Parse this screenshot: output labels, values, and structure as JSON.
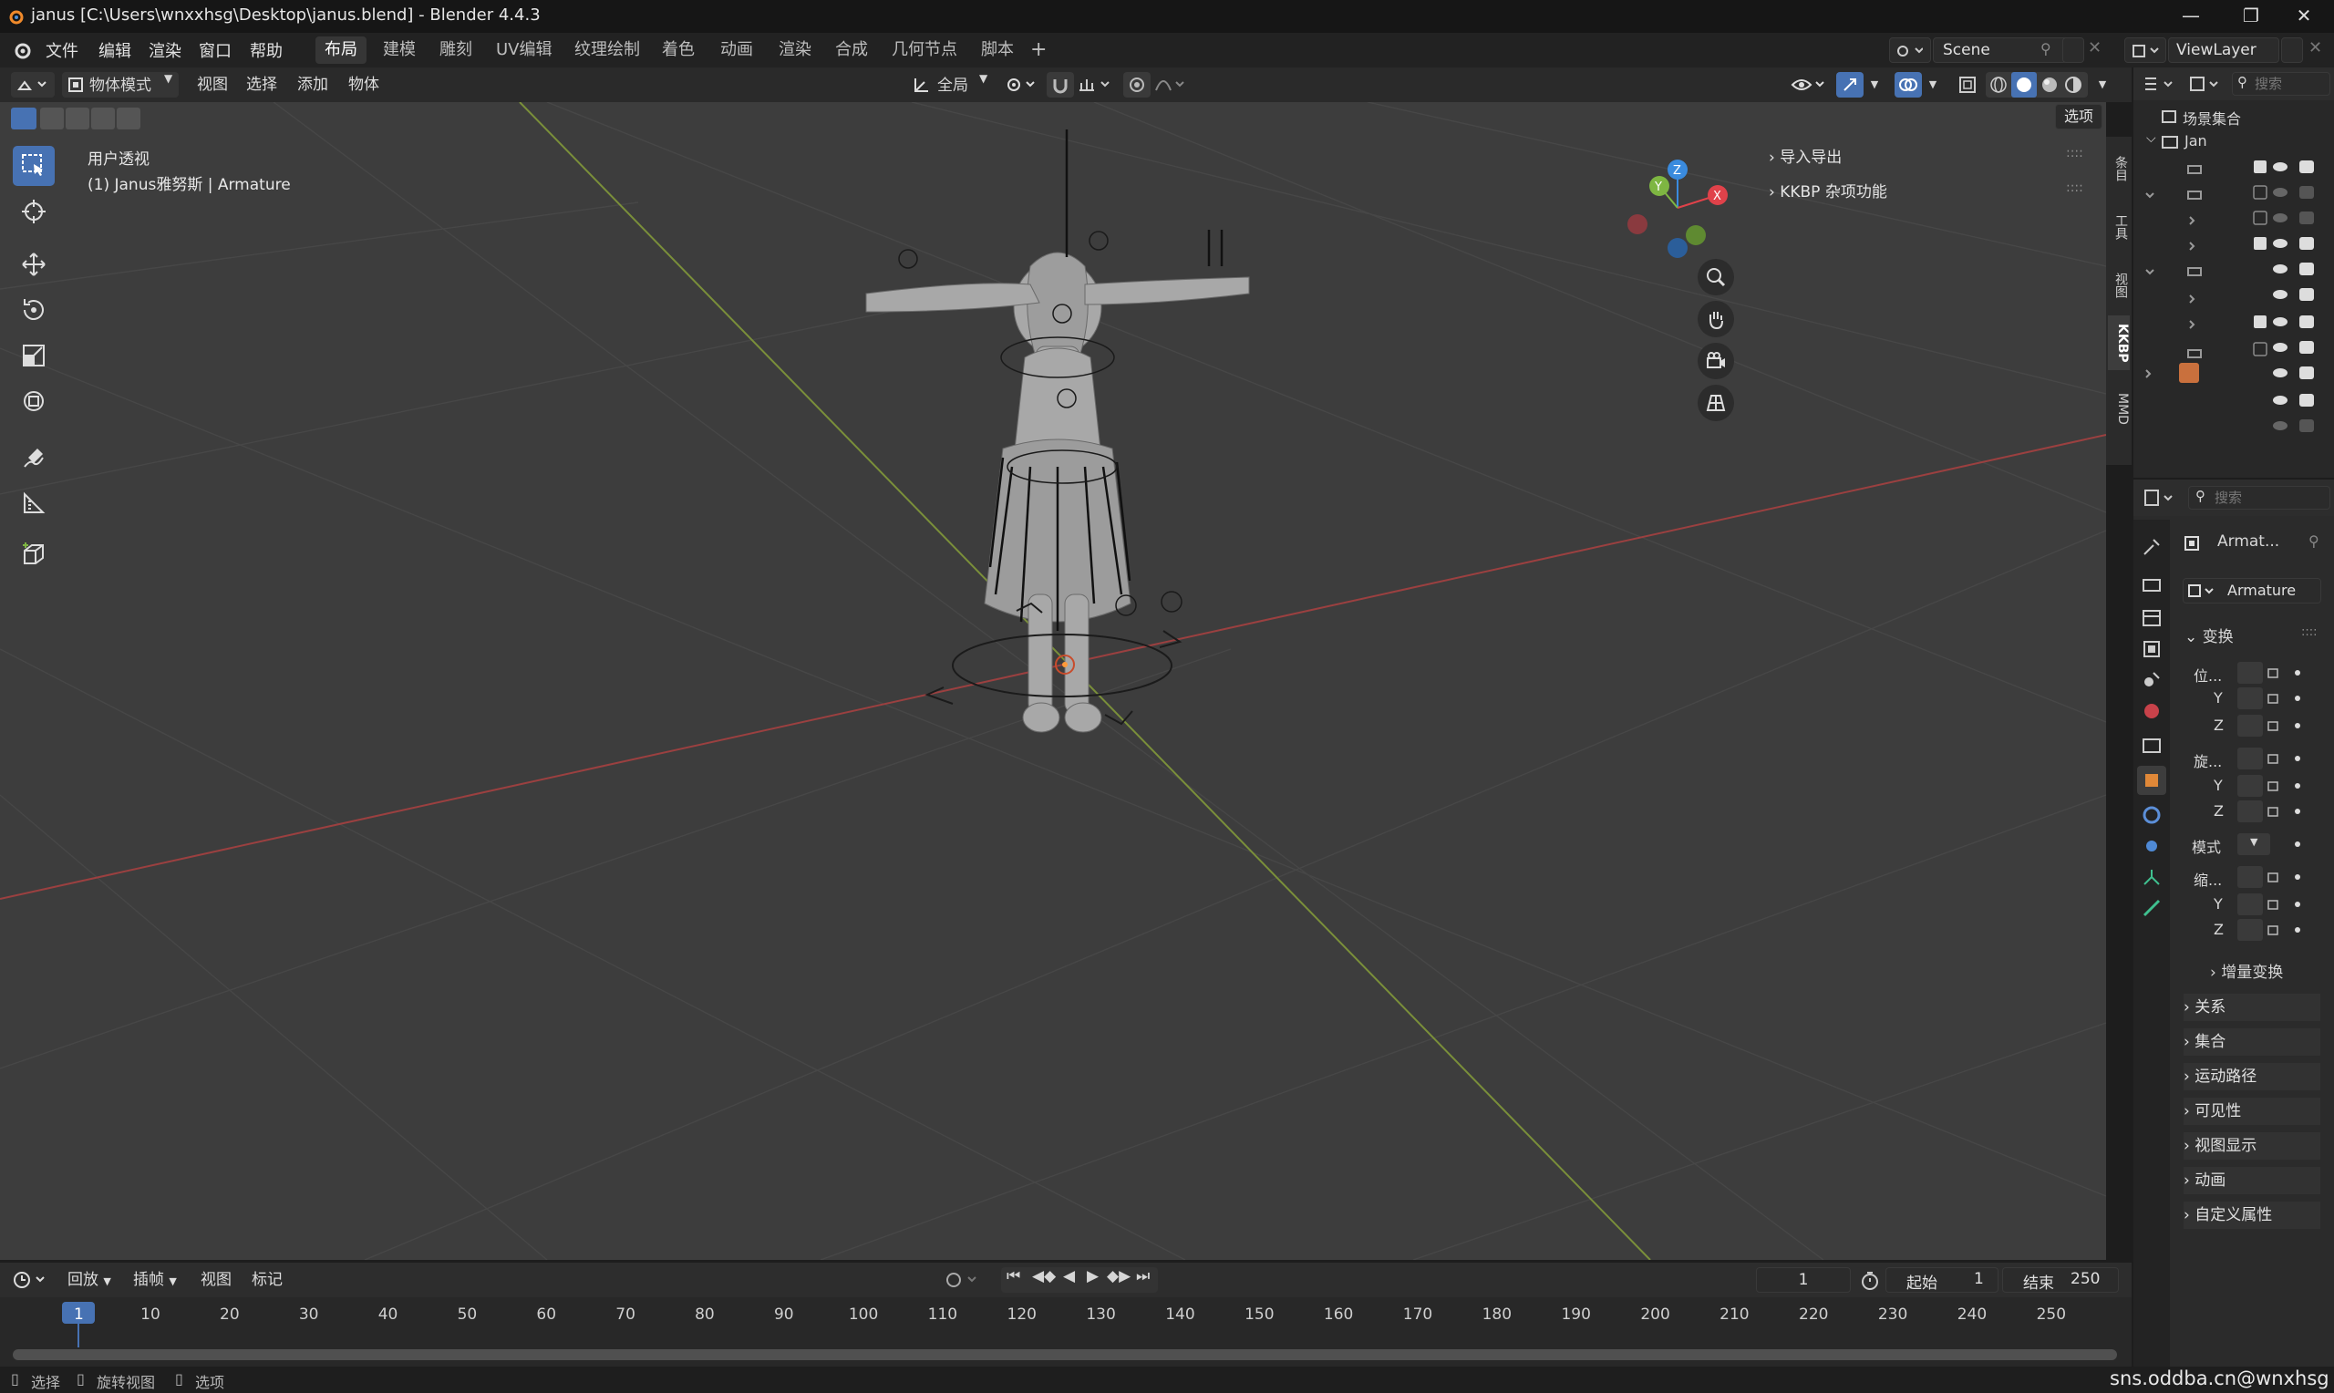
{
  "window": {
    "title": "janus [C:\\Users\\wnxxhsg\\Desktop\\janus.blend] - Blender 4.4.3"
  },
  "menu": [
    "文件",
    "编辑",
    "渲染",
    "窗口",
    "帮助"
  ],
  "workspaces": [
    "布局",
    "建模",
    "雕刻",
    "UV编辑",
    "纹理绘制",
    "着色",
    "动画",
    "渲染",
    "合成",
    "几何节点",
    "脚本"
  ],
  "active_workspace": "布局",
  "scene": {
    "name": "Scene",
    "view_layer": "ViewLayer"
  },
  "viewport_header": {
    "mode": "物体模式",
    "items": [
      "视图",
      "选择",
      "添加",
      "物体"
    ],
    "orientation": "全局",
    "options": "选项"
  },
  "viewport": {
    "view_name": "用户透视",
    "object_info": "(1) Janus雅努斯 | Armature"
  },
  "npanel": {
    "items": [
      "导入导出",
      "KKBP 杂项功能"
    ],
    "tabs": [
      "条目",
      "工具",
      "视图",
      "KKBP",
      "MMD"
    ]
  },
  "gizmo": {
    "x": "X",
    "y": "Y",
    "z": "Z"
  },
  "outliner": {
    "root": "场景集合",
    "first": "Jan",
    "search_placeholder": "搜索"
  },
  "properties": {
    "search_placeholder": "搜索",
    "object_name": "Armat...",
    "data_name": "Armature",
    "transform_header": "变换",
    "location": "位...",
    "rotation": "旋...",
    "scale": "缩...",
    "mode": "模式",
    "y": "Y",
    "z": "Z",
    "delta": "增量变换",
    "panels": [
      "关系",
      "集合",
      "运动路径",
      "可见性",
      "视图显示",
      "动画",
      "自定义属性"
    ]
  },
  "timeline": {
    "menus": [
      "回放",
      "插帧",
      "视图",
      "标记"
    ],
    "current_frame": "1",
    "start_label": "起始",
    "start": "1",
    "end_label": "结束",
    "end": "250",
    "ticks": [
      "1",
      "10",
      "20",
      "30",
      "40",
      "50",
      "60",
      "70",
      "80",
      "90",
      "100",
      "110",
      "120",
      "130",
      "140",
      "150",
      "160",
      "170",
      "180",
      "190",
      "200",
      "210",
      "220",
      "230",
      "240",
      "250"
    ]
  },
  "status": {
    "items": [
      "选择",
      "旋转视图",
      "选项"
    ],
    "watermark": "sns.oddba.cn@wnxhsg"
  },
  "colors": {
    "accent": "#4772b3",
    "x_axis": "#e0424a",
    "y_axis": "#7eb642",
    "z_axis": "#3a8bde",
    "viewport_bg": "#3d3d3d"
  }
}
